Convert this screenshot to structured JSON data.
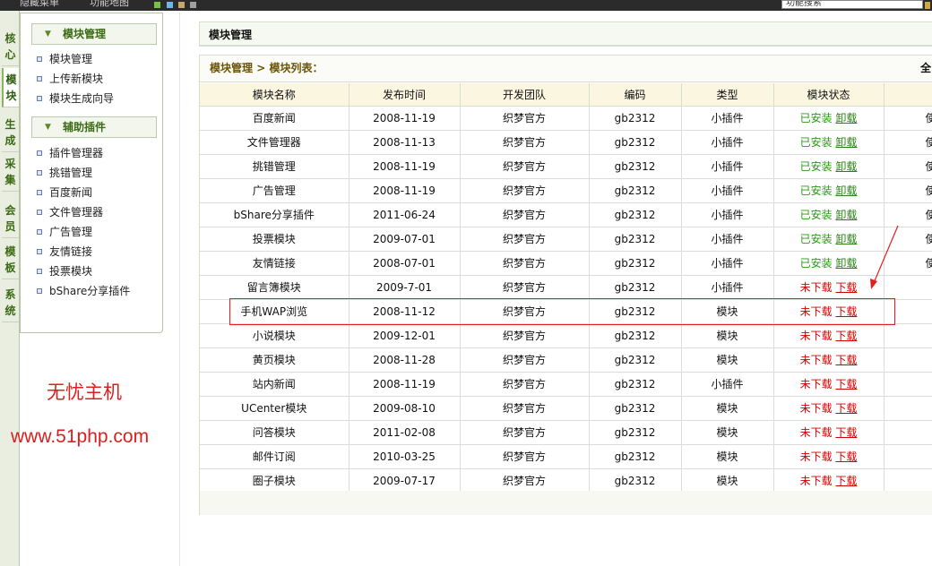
{
  "topbar": {
    "hidden_menu": "隐藏菜单",
    "site_map": "功能地图",
    "search_value": "功能搜索",
    "swatch_colors": [
      "#7bc043",
      "#6cb6e8",
      "#c8a86a",
      "#a0a0a0"
    ]
  },
  "side_tabs": [
    {
      "label": "核心",
      "active": false
    },
    {
      "label": "模块",
      "active": true
    },
    {
      "label": "生成",
      "active": false
    },
    {
      "label": "采集",
      "active": false
    },
    {
      "label": "会员",
      "active": false
    },
    {
      "label": "模板",
      "active": false
    },
    {
      "label": "系统",
      "active": false
    }
  ],
  "menu": {
    "groups": [
      {
        "title": "模块管理",
        "items": [
          "模块管理",
          "上传新模块",
          "模块生成向导"
        ]
      },
      {
        "title": "辅助插件",
        "items": [
          "插件管理器",
          "挑错管理",
          "百度新闻",
          "文件管理器",
          "广告管理",
          "友情链接",
          "投票模块",
          "bShare分享插件"
        ]
      }
    ]
  },
  "watermark": {
    "line1": "无忧主机",
    "line2": "www.51php.com"
  },
  "main": {
    "title": "模块管理",
    "breadcrumb": {
      "root": "模块管理",
      "sep": " > ",
      "current": "模块列表："
    },
    "edge_text": "全",
    "columns": [
      "模块名称",
      "发布时间",
      "开发团队",
      "编码",
      "类型",
      "模块状态",
      ""
    ],
    "rows": [
      {
        "name": "百度新闻",
        "date": "2008-11-19",
        "team": "织梦官方",
        "code": "gb2312",
        "type": "小插件",
        "status": "已安装",
        "action": "卸载",
        "extra": "使"
      },
      {
        "name": "文件管理器",
        "date": "2008-11-13",
        "team": "织梦官方",
        "code": "gb2312",
        "type": "小插件",
        "status": "已安装",
        "action": "卸载",
        "extra": "使"
      },
      {
        "name": "挑错管理",
        "date": "2008-11-19",
        "team": "织梦官方",
        "code": "gb2312",
        "type": "小插件",
        "status": "已安装",
        "action": "卸载",
        "extra": "使"
      },
      {
        "name": "广告管理",
        "date": "2008-11-19",
        "team": "织梦官方",
        "code": "gb2312",
        "type": "小插件",
        "status": "已安装",
        "action": "卸载",
        "extra": "使"
      },
      {
        "name": "bShare分享插件",
        "date": "2011-06-24",
        "team": "织梦官方",
        "code": "gb2312",
        "type": "小插件",
        "status": "已安装",
        "action": "卸载",
        "extra": "使"
      },
      {
        "name": "投票模块",
        "date": "2009-07-01",
        "team": "织梦官方",
        "code": "gb2312",
        "type": "小插件",
        "status": "已安装",
        "action": "卸载",
        "extra": "使"
      },
      {
        "name": "友情链接",
        "date": "2008-07-01",
        "team": "织梦官方",
        "code": "gb2312",
        "type": "小插件",
        "status": "已安装",
        "action": "卸载",
        "extra": "使"
      },
      {
        "name": "留言簿模块",
        "date": "2009-7-01",
        "team": "织梦官方",
        "code": "gb2312",
        "type": "小插件",
        "status": "未下载",
        "action": "下载",
        "extra": ""
      },
      {
        "name": "手机WAP浏览",
        "date": "2008-11-12",
        "team": "织梦官方",
        "code": "gb2312",
        "type": "模块",
        "status": "未下载",
        "action": "下载",
        "extra": ""
      },
      {
        "name": "小说模块",
        "date": "2009-12-01",
        "team": "织梦官方",
        "code": "gb2312",
        "type": "模块",
        "status": "未下载",
        "action": "下载",
        "extra": ""
      },
      {
        "name": "黄页模块",
        "date": "2008-11-28",
        "team": "织梦官方",
        "code": "gb2312",
        "type": "模块",
        "status": "未下载",
        "action": "下载",
        "extra": ""
      },
      {
        "name": "站内新闻",
        "date": "2008-11-19",
        "team": "织梦官方",
        "code": "gb2312",
        "type": "小插件",
        "status": "未下载",
        "action": "下载",
        "extra": ""
      },
      {
        "name": "UCenter模块",
        "date": "2009-08-10",
        "team": "织梦官方",
        "code": "gb2312",
        "type": "模块",
        "status": "未下载",
        "action": "下载",
        "extra": ""
      },
      {
        "name": "问答模块",
        "date": "2011-02-08",
        "team": "织梦官方",
        "code": "gb2312",
        "type": "模块",
        "status": "未下载",
        "action": "下载",
        "extra": ""
      },
      {
        "name": "邮件订阅",
        "date": "2010-03-25",
        "team": "织梦官方",
        "code": "gb2312",
        "type": "模块",
        "status": "未下载",
        "action": "下载",
        "extra": ""
      },
      {
        "name": "圈子模块",
        "date": "2009-07-17",
        "team": "织梦官方",
        "code": "gb2312",
        "type": "模块",
        "status": "未下载",
        "action": "下载",
        "extra": ""
      }
    ],
    "highlighted_row": 8
  },
  "colors": {
    "installed": "#2a9a15",
    "not_downloaded": "#d10000",
    "accent_green": "#3b6a14",
    "annotation_red": "#e02020"
  }
}
